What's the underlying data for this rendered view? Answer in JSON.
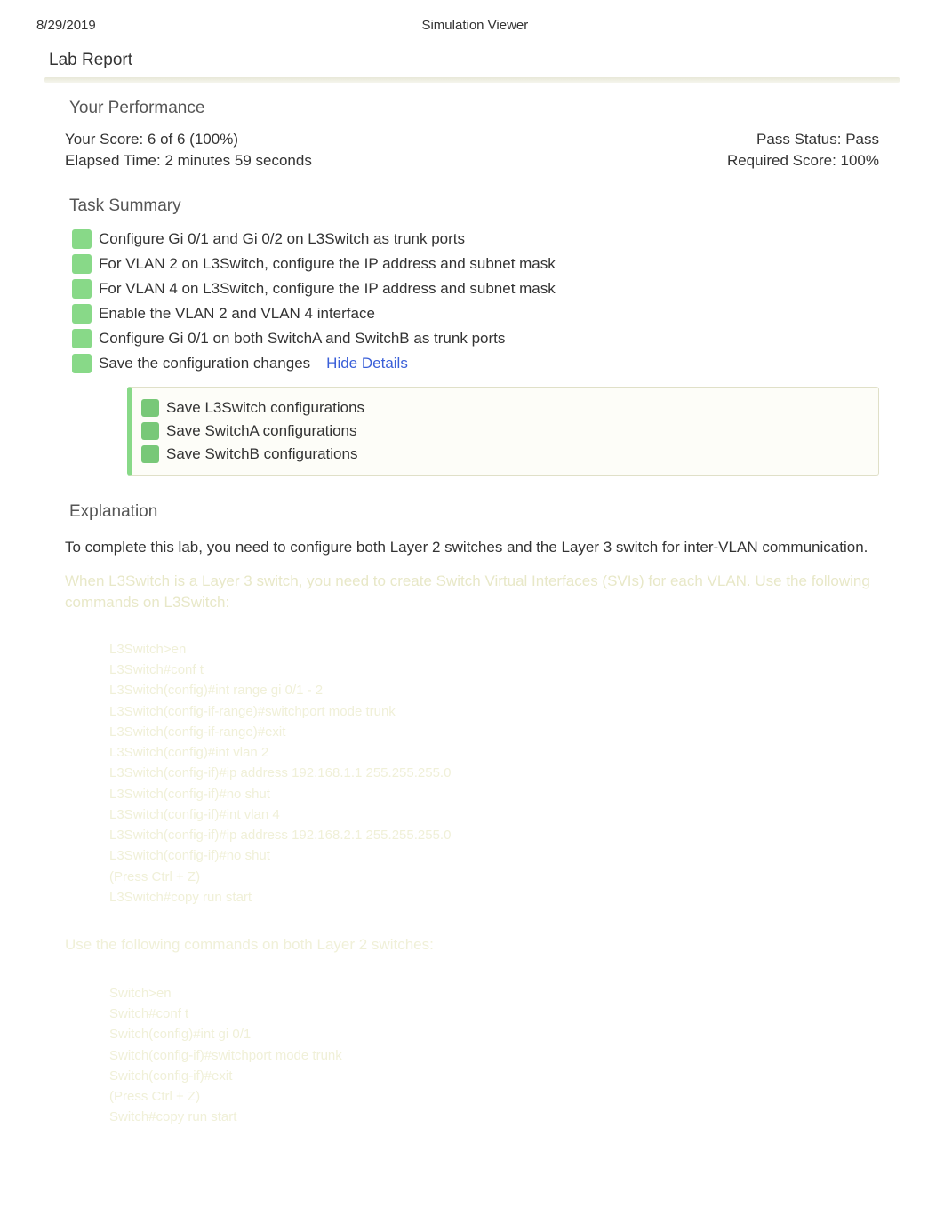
{
  "header": {
    "date": "8/29/2019",
    "title": "Simulation Viewer"
  },
  "report_title": "Lab Report",
  "performance": {
    "heading": "Your Performance",
    "score_label": "Your Score: 6 of 6 (100%)",
    "pass_status": "Pass Status: Pass",
    "elapsed_time": "Elapsed Time: 2 minutes 59 seconds",
    "required_score": "Required Score: 100%"
  },
  "task_summary": {
    "heading": "Task Summary",
    "tasks": [
      "Configure Gi 0/1 and Gi 0/2 on L3Switch as trunk ports",
      "For VLAN 2 on L3Switch, configure the IP address and subnet mask",
      "For VLAN 4 on L3Switch, configure the IP address and subnet mask",
      "Enable the VLAN 2 and VLAN 4 interface",
      "Configure Gi 0/1 on both SwitchA and SwitchB as trunk ports",
      "Save the configuration changes"
    ],
    "hide_details": "Hide Details",
    "details": [
      "Save L3Switch configurations",
      "Save SwitchA configurations",
      "Save SwitchB configurations"
    ]
  },
  "explanation": {
    "heading": "Explanation",
    "intro": "To complete this lab, you need to configure both Layer 2 switches and the Layer 3 switch for inter-VLAN communication.",
    "intro2": "When L3Switch is a Layer 3 switch, you need to create Switch Virtual Interfaces (SVIs) for each VLAN. Use the following commands on L3Switch:",
    "code1": "L3Switch>en\nL3Switch#conf t\nL3Switch(config)#int range gi 0/1 - 2\nL3Switch(config-if-range)#switchport mode trunk\nL3Switch(config-if-range)#exit\nL3Switch(config)#int vlan 2\nL3Switch(config-if)#ip address 192.168.1.1 255.255.255.0\nL3Switch(config-if)#no shut\nL3Switch(config-if)#int vlan 4\nL3Switch(config-if)#ip address 192.168.2.1 255.255.255.0\nL3Switch(config-if)#no shut\n(Press Ctrl + Z)\nL3Switch#copy run start",
    "mid_text": "Use the following commands on both Layer 2 switches:",
    "code2": "Switch>en\nSwitch#conf t\nSwitch(config)#int gi 0/1\nSwitch(config-if)#switchport mode trunk\nSwitch(config-if)#exit\n(Press Ctrl + Z)\nSwitch#copy run start"
  }
}
